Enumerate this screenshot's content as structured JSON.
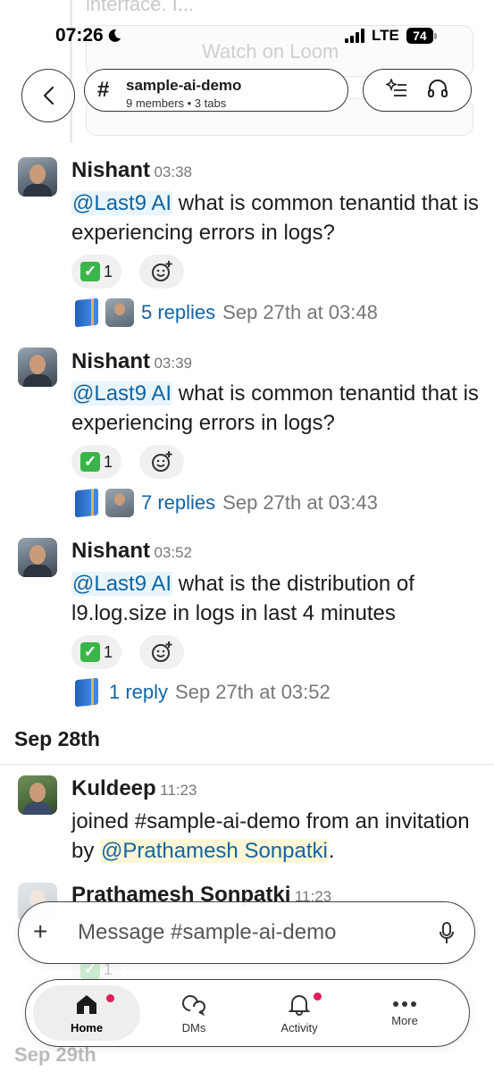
{
  "status_bar": {
    "time": "07:26",
    "network": "LTE",
    "battery": "74"
  },
  "background": {
    "ghost_text": "interface. I...",
    "loom": "Watch on Loom"
  },
  "header": {
    "channel_name": "sample-ai-demo",
    "channel_meta": "9 members • 3 tabs",
    "icons": [
      "back-chevron-icon",
      "sparkle-list-icon",
      "headphones-icon"
    ]
  },
  "messages": [
    {
      "author": "Nishant",
      "time": "03:38",
      "mention": "@Last9 AI",
      "text": " what is common tenantid that is experiencing errors in logs?",
      "reaction_count": "1",
      "replies": "5 replies",
      "reply_time": "Sep 27th at 03:48"
    },
    {
      "author": "Nishant",
      "time": "03:39",
      "mention": "@Last9 AI",
      "text": " what is common tenantid that is experiencing errors in logs?",
      "reaction_count": "1",
      "replies": "7 replies",
      "reply_time": "Sep 27th at 03:43"
    },
    {
      "author": "Nishant",
      "time": "03:52",
      "mention": "@Last9 AI",
      "text": " what is the distribution of l9.log.size in logs in last 4 minutes",
      "reaction_count": "1",
      "replies": "1 reply",
      "reply_time": "Sep 27th at 03:52"
    }
  ],
  "date_divider": "Sep 28th",
  "join_message": {
    "author": "Kuldeep",
    "time": "11:23",
    "text_before": "joined #sample-ai-demo from an invitation by ",
    "mention": "@Prathamesh Sonpatki",
    "text_after": "."
  },
  "partial_message": {
    "author": "Prathamesh Sonpatki",
    "time": "11:23"
  },
  "composer": {
    "placeholder": "Message #sample-ai-demo"
  },
  "tabbar": {
    "tabs": [
      {
        "label": "Home",
        "icon": "home-icon",
        "active": true
      },
      {
        "label": "DMs",
        "icon": "dms-icon"
      },
      {
        "label": "Activity",
        "icon": "bell-icon"
      },
      {
        "label": "More",
        "icon": "more-dots-icon"
      }
    ]
  },
  "bottom_ghost": {
    "date": "Sep 29th"
  },
  "colors": {
    "link": "#1264a3",
    "mention_bg": "#e8f5fa",
    "notification": "#e01e5a",
    "check": "#3bb54a"
  }
}
